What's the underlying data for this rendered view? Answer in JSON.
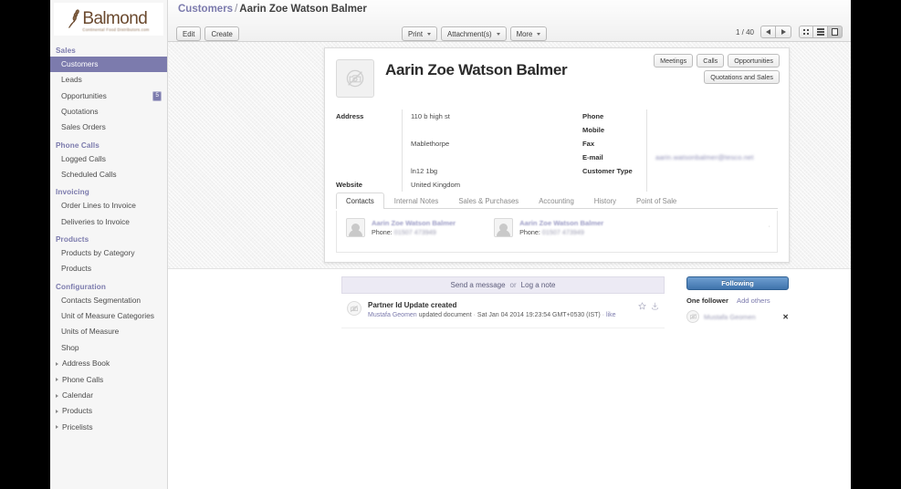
{
  "app": {
    "logo_word": "Balmond",
    "logo_tagline": "Continental Food Distributors.com"
  },
  "sidebar": {
    "sections": [
      {
        "title": "Sales",
        "items": [
          {
            "label": "Customers",
            "active": true,
            "badge": ""
          },
          {
            "label": "Leads",
            "active": false,
            "badge": ""
          },
          {
            "label": "Opportunities",
            "active": false,
            "badge": "5"
          },
          {
            "label": "Quotations",
            "active": false,
            "badge": ""
          },
          {
            "label": "Sales Orders",
            "active": false,
            "badge": ""
          }
        ]
      },
      {
        "title": "Phone Calls",
        "items": [
          {
            "label": "Logged Calls",
            "active": false,
            "badge": ""
          },
          {
            "label": "Scheduled Calls",
            "active": false,
            "badge": ""
          }
        ]
      },
      {
        "title": "Invoicing",
        "items": [
          {
            "label": "Order Lines to Invoice",
            "active": false,
            "badge": ""
          },
          {
            "label": "Deliveries to Invoice",
            "active": false,
            "badge": ""
          }
        ]
      },
      {
        "title": "Products",
        "items": [
          {
            "label": "Products by Category",
            "active": false,
            "badge": ""
          },
          {
            "label": "Products",
            "active": false,
            "badge": ""
          }
        ]
      },
      {
        "title": "Configuration",
        "items": [
          {
            "label": "Contacts Segmentation",
            "active": false,
            "badge": ""
          },
          {
            "label": "Unit of Measure Categories",
            "active": false,
            "badge": ""
          },
          {
            "label": "Units of Measure",
            "active": false,
            "badge": ""
          },
          {
            "label": "Shop",
            "active": false,
            "badge": ""
          }
        ]
      }
    ],
    "collapsed": [
      {
        "label": "Address Book"
      },
      {
        "label": "Phone Calls"
      },
      {
        "label": "Calendar"
      },
      {
        "label": "Products"
      },
      {
        "label": "Pricelists"
      }
    ]
  },
  "topbar": {
    "breadcrumb_root": "Customers",
    "breadcrumb_sep": "/",
    "breadcrumb_current": "Aarin Zoe Watson Balmer",
    "edit_label": "Edit",
    "create_label": "Create",
    "print_label": "Print",
    "attachments_label": "Attachment(s)",
    "more_label": "More",
    "pager": "1 / 40"
  },
  "record": {
    "name": "Aarin Zoe Watson Balmer",
    "buttons": {
      "meetings": "Meetings",
      "calls": "Calls",
      "opportunities": "Opportunities",
      "quotations_and_sales": "Quotations and Sales"
    },
    "left_labels": {
      "address": "Address",
      "website": "Website"
    },
    "address_lines": [
      "110 b high st",
      "",
      "Mablethorpe",
      "",
      "ln12 1bg",
      "United Kingdom"
    ],
    "website_value": "",
    "right_fields": [
      {
        "label": "Phone",
        "value": "",
        "redacted": false
      },
      {
        "label": "Mobile",
        "value": "",
        "redacted": false
      },
      {
        "label": "Fax",
        "value": "",
        "redacted": false
      },
      {
        "label": "E-mail",
        "value": "aarin.watsonbalmer@tesco.net",
        "redacted": true
      },
      {
        "label": "Customer Type",
        "value": "",
        "redacted": false
      }
    ],
    "tabs": [
      {
        "label": "Contacts",
        "active": true
      },
      {
        "label": "Internal Notes",
        "active": false
      },
      {
        "label": "Sales & Purchases",
        "active": false
      },
      {
        "label": "Accounting",
        "active": false
      },
      {
        "label": "History",
        "active": false
      },
      {
        "label": "Point of Sale",
        "active": false
      }
    ],
    "contacts": [
      {
        "name": "Aarin Zoe Watson Balmer",
        "phone_label": "Phone:",
        "phone": "01507 473949"
      },
      {
        "name": "Aarin Zoe Watson Balmer",
        "phone_label": "Phone:",
        "phone": "01507 473949"
      }
    ]
  },
  "chatter": {
    "send_message": "Send a message",
    "or": "or",
    "log_note": "Log a note",
    "messages": [
      {
        "subject": "Partner Id Update created",
        "author": "Mustafa Geomen",
        "action": "updated document",
        "sep1": "·",
        "timestamp": "Sat Jan 04 2014 19:23:54 GMT+0530 (IST)",
        "sep2": "·",
        "like": "like"
      }
    ],
    "follow_button": "Following",
    "follower_count": "One follower",
    "add_others": "Add others",
    "followers": [
      {
        "name": "Mustafa Geomen",
        "remove": "✕"
      }
    ]
  },
  "colors": {
    "accent": "#7c7bad",
    "follow_button": "#3f73ac",
    "logo": "#6b4a2f"
  }
}
